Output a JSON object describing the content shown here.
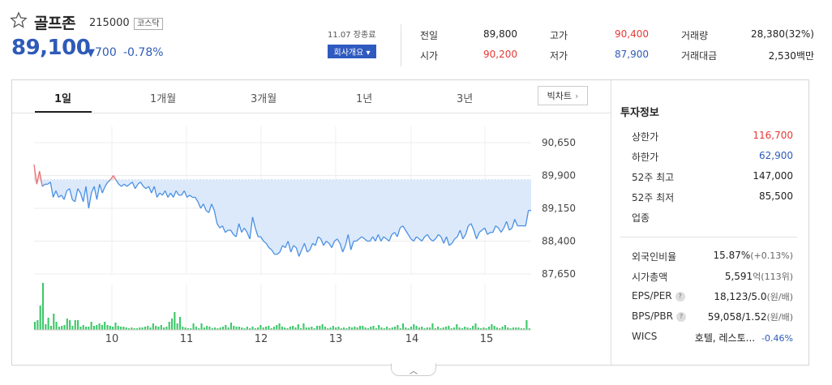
{
  "header": {
    "name": "골프존",
    "code": "215000",
    "market": "코스닥",
    "price": "89,100",
    "change_symbol": "▼",
    "change": "700",
    "change_pct": "-0.78%",
    "date_info": "11.07 장종료",
    "company_btn": "회사개요 ▾"
  },
  "stats": {
    "prev_close_label": "전일",
    "prev_close": "89,800",
    "high_label": "고가",
    "high": "90,400",
    "volume_label": "거래량",
    "volume": "28,380(32%)",
    "open_label": "시가",
    "open": "90,200",
    "low_label": "저가",
    "low": "87,900",
    "trade_value_label": "거래대금",
    "trade_value": "2,530백만"
  },
  "tabs": [
    "1일",
    "1개월",
    "3개월",
    "1년",
    "3년"
  ],
  "bigchart_label": "빅차트",
  "invest": {
    "title": "투자정보",
    "rows": [
      {
        "label": "상한가",
        "value": "116,700",
        "color": "#e53935"
      },
      {
        "label": "하한가",
        "value": "62,900",
        "color": "#2e5bb8"
      },
      {
        "label": "52주 최고",
        "value": "147,000"
      },
      {
        "label": "52주 최저",
        "value": "85,500"
      },
      {
        "label": "업종",
        "value": ""
      }
    ],
    "rows2": [
      {
        "label": "외국인비율",
        "value": "15.87%",
        "extra": "(+0.13%)"
      },
      {
        "label": "시가총액",
        "value": "5,591",
        "extra": "억(113위)"
      },
      {
        "label": "EPS/PER",
        "value": "18,123/5.0",
        "extra": "(원/배)",
        "q": true
      },
      {
        "label": "BPS/PBR",
        "value": "59,058/1.52",
        "extra": "(원/배)",
        "q": true
      },
      {
        "label": "WICS",
        "value": "호텔, 레스토...",
        "extra": "-0.46%",
        "extra_color": "#2e5bb8"
      }
    ]
  },
  "chart_data": {
    "type": "line",
    "title": "",
    "x_tick_labels": [
      "10",
      "11",
      "12",
      "13",
      "14",
      "15"
    ],
    "y_tick_labels": [
      "90,650",
      "89,900",
      "89,150",
      "88,400",
      "87,650"
    ],
    "ylim": [
      87650,
      90650
    ],
    "reference_price": 89800,
    "price_series": [
      90150,
      89700,
      90000,
      89650,
      89700,
      89700,
      89750,
      89400,
      89550,
      89400,
      89450,
      89350,
      89550,
      89600,
      89350,
      89300,
      89600,
      89500,
      89300,
      89650,
      89150,
      89500,
      89650,
      89350,
      89700,
      89500,
      89650,
      89750,
      89800,
      89900,
      89800,
      89700,
      89650,
      89700,
      89650,
      89700,
      89750,
      89600,
      89700,
      89750,
      89650,
      89600,
      89650,
      89500,
      89650,
      89400,
      89500,
      89450,
      89550,
      89400,
      89500,
      89400,
      89550,
      89450,
      89450,
      89550,
      89400,
      89450,
      89400,
      89400,
      89300,
      89150,
      89250,
      89100,
      89050,
      89250,
      89100,
      88800,
      88700,
      88750,
      88600,
      88650,
      88650,
      88550,
      88500,
      88800,
      88600,
      88700,
      88600,
      88450,
      88950,
      88700,
      88500,
      88500,
      88400,
      88350,
      88250,
      88200,
      88100,
      88100,
      88150,
      88300,
      88250,
      88400,
      88150,
      88300,
      88250,
      88050,
      88200,
      88350,
      88150,
      88200,
      88350,
      88300,
      88500,
      88450,
      88300,
      88400,
      88350,
      88250,
      88400,
      88450,
      88350,
      88150,
      88300,
      88550,
      88200,
      88400,
      88400,
      88450,
      88500,
      88450,
      88400,
      88400,
      88500,
      88400,
      88550,
      88400,
      88500,
      88450,
      88400,
      88550,
      88600,
      88500,
      88700,
      88750,
      88650,
      88550,
      88450,
      88400,
      88500,
      88450,
      88400,
      88500,
      88550,
      88450,
      88400,
      88450,
      88550,
      88500,
      88350,
      88500,
      88300,
      88350,
      88450,
      88500,
      88650,
      88450,
      88550,
      88750,
      88800,
      88650,
      88450,
      88600,
      88650,
      88700,
      88550,
      88600,
      88600,
      88750,
      88700,
      88600,
      88700,
      88850,
      88650,
      88700,
      88900,
      88750,
      88750,
      88750,
      88750,
      89100,
      89100
    ],
    "volume_series": [
      10,
      12,
      30,
      58,
      7,
      15,
      5,
      20,
      10,
      4,
      5,
      6,
      14,
      12,
      5,
      12,
      12,
      4,
      6,
      4,
      4,
      10,
      5,
      6,
      8,
      6,
      10,
      6,
      5,
      4,
      9,
      5,
      4,
      4,
      3,
      2,
      3,
      2,
      2,
      3,
      3,
      4,
      5,
      3,
      8,
      5,
      4,
      6,
      3,
      4,
      10,
      14,
      22,
      8,
      16,
      4,
      3,
      2,
      2,
      8,
      4,
      2,
      8,
      3,
      5,
      4,
      2,
      3,
      2,
      3,
      4,
      6,
      3,
      9,
      5,
      4,
      4,
      3,
      2,
      4,
      2,
      4,
      2,
      3,
      6,
      3,
      4,
      5,
      2,
      4,
      6,
      8,
      4,
      3,
      2,
      4,
      5,
      3,
      7,
      2,
      8,
      3,
      3,
      4,
      2,
      5,
      5,
      7,
      4,
      2,
      3,
      5,
      3,
      4,
      2,
      3,
      2,
      4,
      3,
      4,
      3,
      5,
      5,
      3,
      2,
      4,
      5,
      2,
      6,
      3,
      2,
      4,
      2,
      3,
      4,
      6,
      2,
      8,
      3,
      2,
      4,
      7,
      5,
      3,
      4,
      2,
      3,
      3,
      8,
      2,
      4,
      2,
      3,
      4,
      5,
      2,
      3,
      7,
      3,
      2,
      4,
      3,
      2,
      5,
      8,
      3,
      2,
      3,
      2,
      4,
      7,
      5,
      3,
      2,
      4,
      6,
      3,
      2,
      3,
      3,
      3,
      2,
      2,
      12,
      2
    ]
  }
}
